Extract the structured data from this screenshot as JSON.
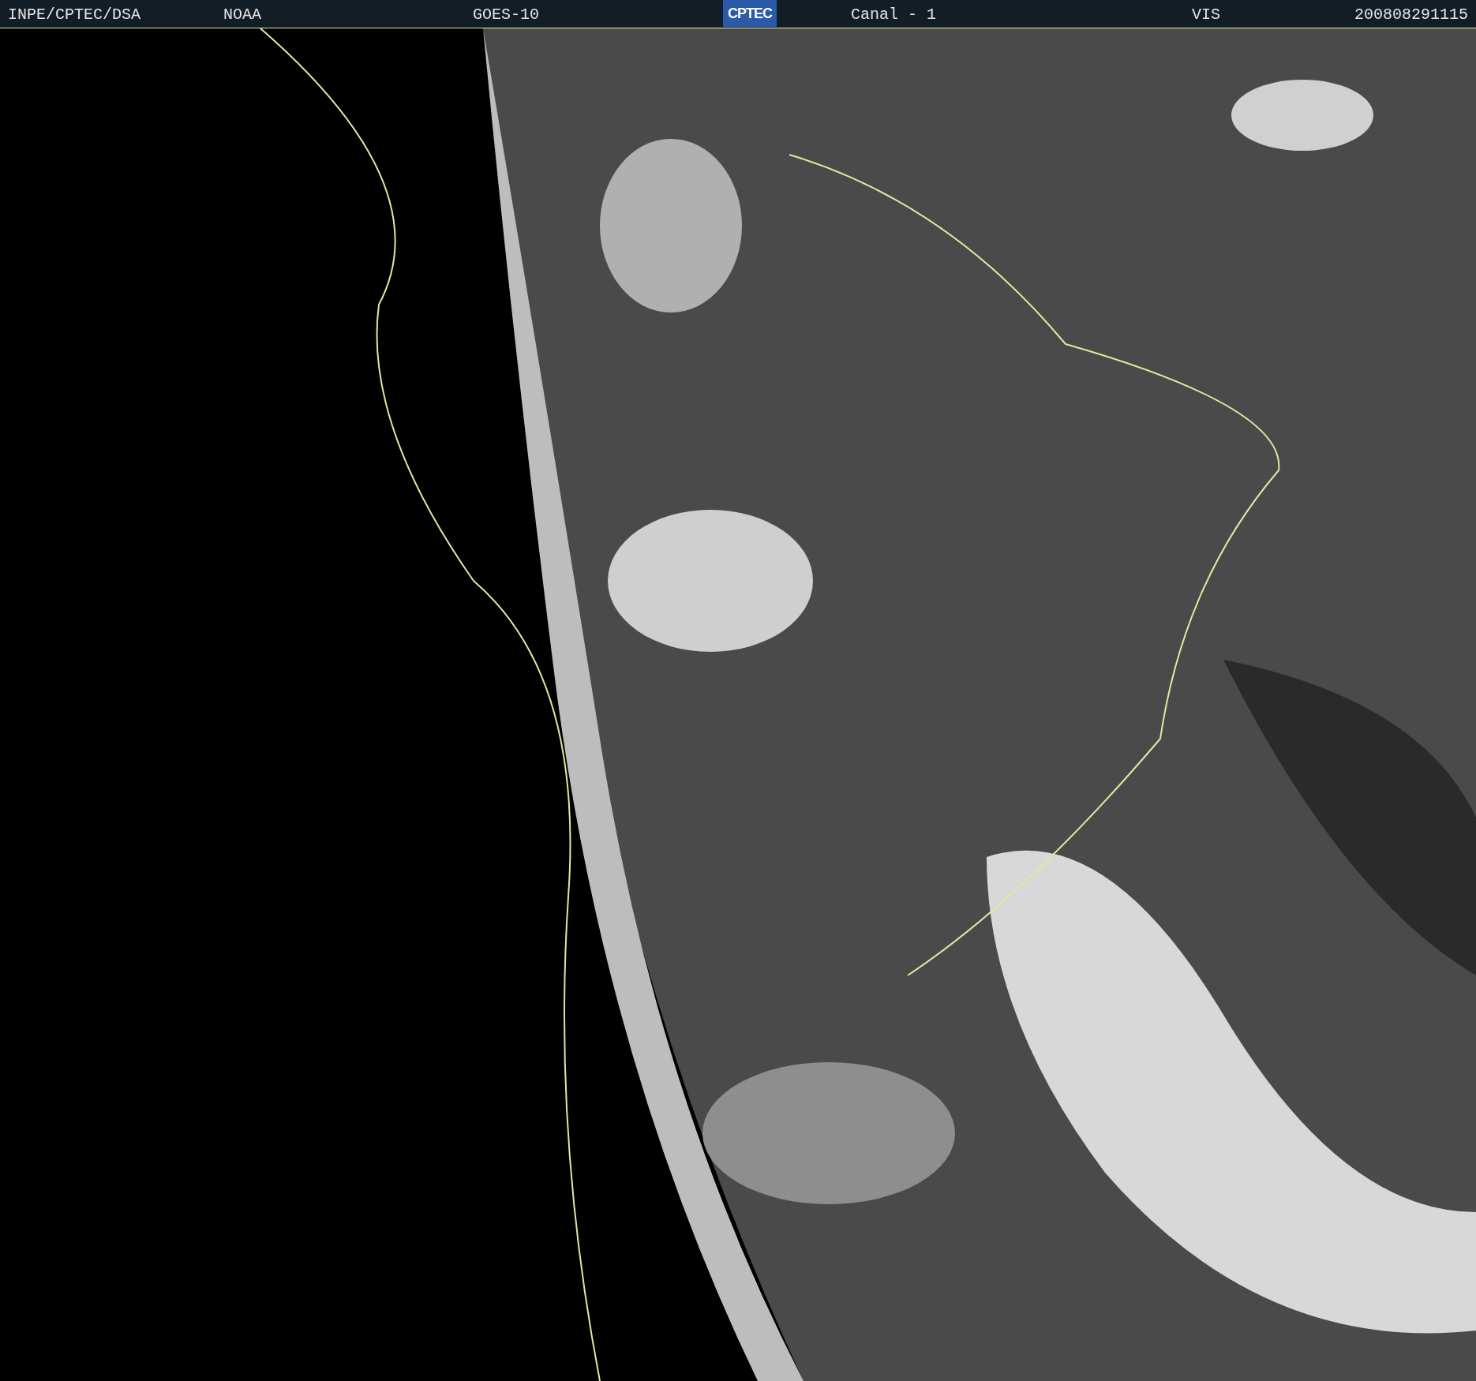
{
  "header": {
    "items": [
      {
        "kind": "text",
        "text": "INPE/CPTEC/DSA"
      },
      {
        "kind": "text",
        "text": "NOAA"
      },
      {
        "kind": "text",
        "text": "GOES-10"
      },
      {
        "kind": "logo",
        "text": "CPTEC"
      },
      {
        "kind": "text",
        "text": "Canal - 1"
      },
      {
        "kind": "text",
        "text": "VIS"
      },
      {
        "kind": "text",
        "text": "200808291115"
      }
    ]
  }
}
